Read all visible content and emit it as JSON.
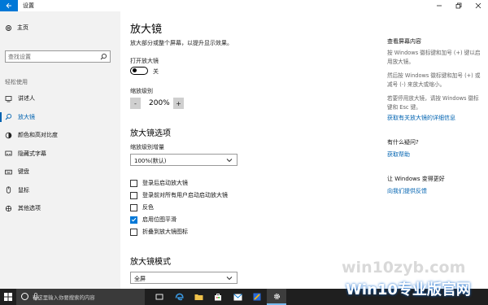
{
  "window": {
    "title": "设置"
  },
  "sidebar": {
    "home_label": "主页",
    "search_placeholder": "查找设置",
    "section_label": "轻松使用",
    "items": [
      {
        "label": "讲述人",
        "icon": "narrator-icon"
      },
      {
        "label": "放大镜",
        "icon": "magnifier-icon",
        "active": true
      },
      {
        "label": "颜色和高对比度",
        "icon": "contrast-icon"
      },
      {
        "label": "隐藏式字幕",
        "icon": "captions-icon"
      },
      {
        "label": "键盘",
        "icon": "keyboard-icon"
      },
      {
        "label": "鼠标",
        "icon": "mouse-icon"
      },
      {
        "label": "其他选项",
        "icon": "other-options-icon"
      }
    ]
  },
  "main": {
    "title": "放大镜",
    "description": "放大部分或整个屏幕，以提升显示效果。",
    "open_label": "打开放大镜",
    "toggle_state": "关",
    "zoom_label": "缩放级别",
    "zoom_minus": "-",
    "zoom_value": "200%",
    "zoom_plus": "+",
    "options_heading": "放大镜选项",
    "increment_label": "缩放级别增量",
    "increment_value": "100%(默认)",
    "checkboxes": [
      {
        "label": "登录后启动放大镜",
        "checked": false
      },
      {
        "label": "登录前对所有用户启动启动放大镜",
        "checked": false
      },
      {
        "label": "反色",
        "checked": false
      },
      {
        "label": "启用位图平滑",
        "checked": true
      },
      {
        "label": "折叠到放大镜图标",
        "checked": false
      }
    ],
    "mode_heading": "放大镜模式",
    "mode_value": "全屏"
  },
  "right_panel": {
    "title1": "查看屏幕内容",
    "text1": "按 Windows 徽标键和加号 (+) 键以启用放大镜。",
    "text2": "然后按 Windows 徽标键和加号 (+) 或减号 (-) 来放大或缩小。",
    "text3": "若要停用放大镜，请按 Windows 徽标键和 Esc 键。",
    "link1": "获取有关放大镜的详细信息",
    "title2": "有什么疑问?",
    "link2": "获取帮助",
    "title3": "让 Windows 变得更好",
    "link3": "向我们提供反馈"
  },
  "taskbar": {
    "search_placeholder": "在这里输入你要搜索的内容"
  },
  "watermark": {
    "line1": "win10zyb.com",
    "line2": "Win10专业版官网"
  },
  "colors": {
    "accent": "#0078d7",
    "link": "#0063b1",
    "taskbar": "#1f1f1f"
  }
}
